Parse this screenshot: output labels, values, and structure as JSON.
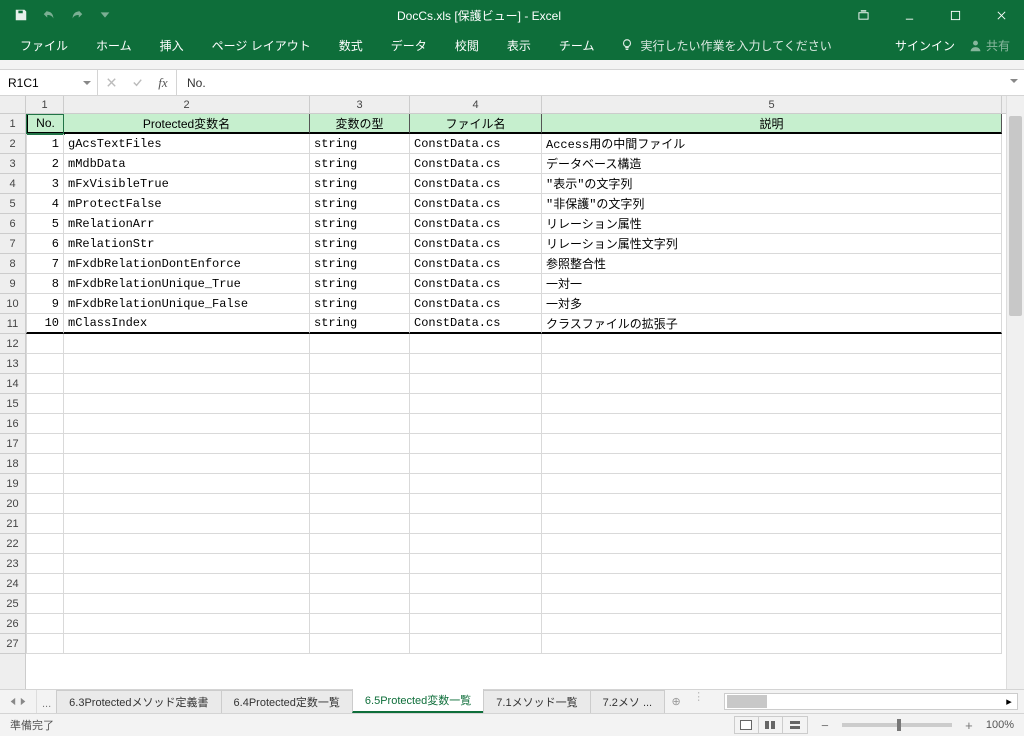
{
  "title": "DocCs.xls  [保護ビュー] - Excel",
  "qat_customize_tooltip": "クイックアクセスツールバーのカスタマイズ",
  "ribbon_tabs": [
    "ファイル",
    "ホーム",
    "挿入",
    "ページ レイアウト",
    "数式",
    "データ",
    "校閲",
    "表示",
    "チーム"
  ],
  "tell_me": "実行したい作業を入力してください",
  "sign_in": "サインイン",
  "share": "共有",
  "name_box": "R1C1",
  "formula_value": "No.",
  "col_numbers": [
    "1",
    "2",
    "3",
    "4",
    "5"
  ],
  "row_numbers": [
    "1",
    "2",
    "3",
    "4",
    "5",
    "6",
    "7",
    "8",
    "9",
    "10",
    "11",
    "12",
    "13",
    "14",
    "15",
    "16",
    "17",
    "18",
    "19",
    "20",
    "21",
    "22",
    "23",
    "24",
    "25",
    "26",
    "27"
  ],
  "headers": {
    "no": "No.",
    "name": "Protected変数名",
    "type": "変数の型",
    "file": "ファイル名",
    "desc": "説明"
  },
  "rows": [
    {
      "no": "1",
      "name": "gAcsTextFiles",
      "type": "string",
      "file": "ConstData.cs",
      "desc": "Access用の中間ファイル"
    },
    {
      "no": "2",
      "name": "mMdbData",
      "type": "string",
      "file": "ConstData.cs",
      "desc": "データベース構造"
    },
    {
      "no": "3",
      "name": "mFxVisibleTrue",
      "type": "string",
      "file": "ConstData.cs",
      "desc": "\"表示\"の文字列"
    },
    {
      "no": "4",
      "name": "mProtectFalse",
      "type": "string",
      "file": "ConstData.cs",
      "desc": "\"非保護\"の文字列"
    },
    {
      "no": "5",
      "name": "mRelationArr",
      "type": "string",
      "file": "ConstData.cs",
      "desc": "リレーション属性"
    },
    {
      "no": "6",
      "name": "mRelationStr",
      "type": "string",
      "file": "ConstData.cs",
      "desc": "リレーション属性文字列"
    },
    {
      "no": "7",
      "name": "mFxdbRelationDontEnforce",
      "type": "string",
      "file": "ConstData.cs",
      "desc": "参照整合性"
    },
    {
      "no": "8",
      "name": "mFxdbRelationUnique_True",
      "type": "string",
      "file": "ConstData.cs",
      "desc": "一対一"
    },
    {
      "no": "9",
      "name": "mFxdbRelationUnique_False",
      "type": "string",
      "file": "ConstData.cs",
      "desc": "一対多"
    },
    {
      "no": "10",
      "name": "mClassIndex",
      "type": "string",
      "file": "ConstData.cs",
      "desc": "クラスファイルの拡張子"
    }
  ],
  "sheet_tabs": [
    {
      "label": "...",
      "dots": true
    },
    {
      "label": "6.3Protectedメソッド定義書"
    },
    {
      "label": "6.4Protected定数一覧"
    },
    {
      "label": "6.5Protected変数一覧",
      "active": true
    },
    {
      "label": "7.1メソッド一覧"
    },
    {
      "label": "7.2メソ ..."
    }
  ],
  "status": "準備完了",
  "zoom": "100%"
}
